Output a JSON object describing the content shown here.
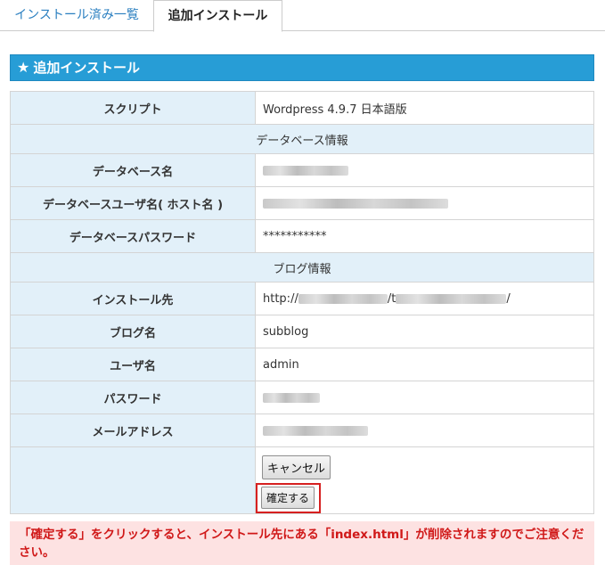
{
  "tabs": [
    {
      "label": "インストール済み一覧",
      "active": false
    },
    {
      "label": "追加インストール",
      "active": true
    }
  ],
  "section": {
    "title": "追加インストール"
  },
  "form": {
    "script": {
      "label": "スクリプト",
      "value": "Wordpress 4.9.7 日本語版"
    },
    "db_section": "データベース情報",
    "db_name": {
      "label": "データベース名"
    },
    "db_user": {
      "label": "データベースユーザ名( ホスト名 )"
    },
    "db_password": {
      "label": "データベースパスワード",
      "value": "***********"
    },
    "blog_section": "ブログ情報",
    "install_dest": {
      "label": "インストール先",
      "prefix": "http://",
      "middle": "/t",
      "suffix": "/"
    },
    "blog_name": {
      "label": "ブログ名",
      "value": "subblog"
    },
    "user_name": {
      "label": "ユーザ名",
      "value": "admin"
    },
    "password": {
      "label": "パスワード"
    },
    "email": {
      "label": "メールアドレス"
    }
  },
  "buttons": {
    "cancel": "キャンセル",
    "confirm": "確定する"
  },
  "warning": "「確定する」をクリックすると、インストール先にある「index.html」が削除されますのでご注意ください。",
  "colors": {
    "header_bg": "#279dd6",
    "label_bg": "#e2f0f9",
    "warning_bg": "#fde2e2",
    "warning_text": "#d01818",
    "highlight_border": "#d62020"
  }
}
